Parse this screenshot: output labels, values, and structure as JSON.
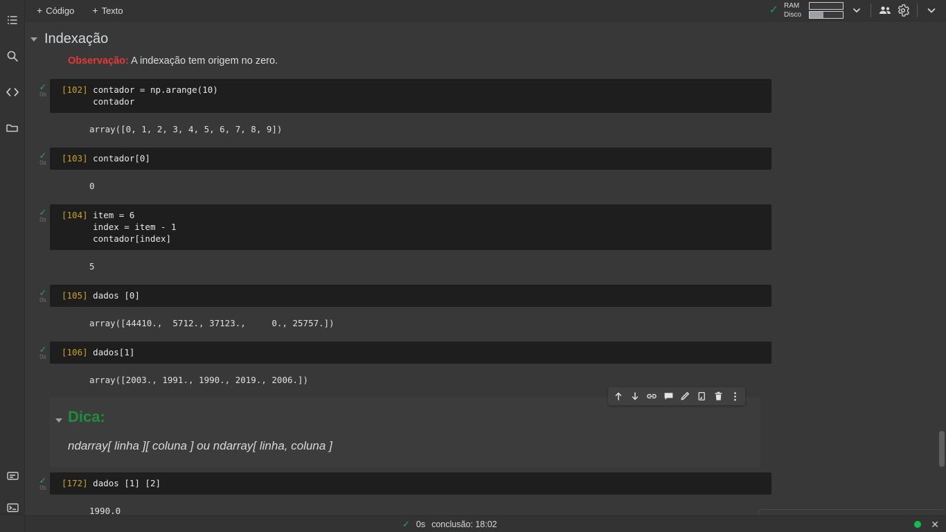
{
  "left_rail": {
    "top_items": [
      {
        "name": "table-of-contents-icon",
        "label": "Índice"
      },
      {
        "name": "search-icon",
        "label": "Pesquisar"
      },
      {
        "name": "code-snippets-icon",
        "label": "Snippets de código"
      },
      {
        "name": "files-icon",
        "label": "Arquivos"
      }
    ],
    "bottom_items": [
      {
        "name": "command-palette-icon",
        "label": "Paleta de comandos"
      },
      {
        "name": "terminal-icon",
        "label": "Terminal"
      }
    ]
  },
  "top_bar": {
    "add_code_label": "Código",
    "add_text_label": "Texto",
    "plus": "+",
    "connection_check": "✓",
    "meters": [
      {
        "label": "RAM",
        "fill_percent": 0
      },
      {
        "label": "Disco",
        "fill_percent": 42
      }
    ],
    "icons": [
      {
        "name": "chevron-down-icon",
        "label": "Mostrar recursos"
      },
      {
        "name": "share-people-icon",
        "label": "Compartilhar"
      },
      {
        "name": "gear-icon",
        "label": "Configurações"
      },
      {
        "name": "expand-chevron-icon",
        "label": "Recolher"
      }
    ]
  },
  "notebook": {
    "section": {
      "title": "Indexação"
    },
    "observation": {
      "warn_label": "Observação:",
      "text": " A indexação tem origem no zero."
    },
    "cells": [
      {
        "prompt": "[102]",
        "code_lines": [
          "contador = np.arange(10)",
          "contador"
        ],
        "output": "array([0, 1, 2, 3, 4, 5, 6, 7, 8, 9])",
        "runtime": "0s",
        "status": "✓"
      },
      {
        "prompt": "[103]",
        "code_lines": [
          "contador[0]"
        ],
        "output": "0",
        "runtime": "0s",
        "status": "✓"
      },
      {
        "prompt": "[104]",
        "code_lines": [
          "item = 6",
          "index = item - 1",
          "contador[index]"
        ],
        "output": "5",
        "runtime": "0s",
        "status": "✓"
      },
      {
        "prompt": "[105]",
        "code_lines": [
          "dados [0]"
        ],
        "output": "array([44410.,  5712., 37123.,     0., 25757.])",
        "runtime": "0s",
        "status": "✓"
      },
      {
        "prompt": "[106]",
        "code_lines": [
          "dados[1]"
        ],
        "output": "array([2003., 1991., 1990., 2019., 2006.])",
        "runtime": "0s",
        "status": "✓"
      }
    ],
    "markdown_cell": {
      "title": "Dica:",
      "body": "ndarray[ linha ][ coluna ] ou ndarray[ linha, coluna ]"
    },
    "last_cell": {
      "prompt": "[172]",
      "code_lines": [
        "dados [1] [2]"
      ],
      "output": "1990.0",
      "runtime": "0s",
      "status": "✓"
    },
    "cell_toolbar": [
      {
        "name": "move-cell-up-icon",
        "label": "Mover célula para cima"
      },
      {
        "name": "move-cell-down-icon",
        "label": "Mover célula para baixo"
      },
      {
        "name": "link-to-cell-icon",
        "label": "Copiar link da célula"
      },
      {
        "name": "comment-icon",
        "label": "Adicionar comentário"
      },
      {
        "name": "edit-icon",
        "label": "Editar"
      },
      {
        "name": "copy-cell-icon",
        "label": "Copiar célula"
      },
      {
        "name": "delete-cell-icon",
        "label": "Excluir célula"
      },
      {
        "name": "more-options-icon",
        "label": "Mais opções de célula"
      }
    ]
  },
  "bottom_bar": {
    "status_check": "✓",
    "elapsed": "0s",
    "completion_label": "conclusão: 18:02",
    "close_label": "✕"
  },
  "colors": {
    "page_background": "#383838",
    "chrome_background": "#333333",
    "code_background": "#1e1e1e",
    "selected_cell_background": "#3c3c3c",
    "accent_green": "#1e8e3e",
    "warn_red": "#e53935",
    "prompt_amber": "#c9a227",
    "status_dot_green": "#0fbf56"
  }
}
